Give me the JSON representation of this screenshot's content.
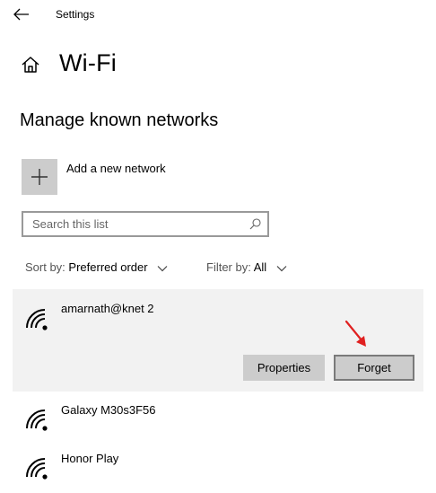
{
  "titlebar": {
    "app_title": "Settings",
    "back_icon": "arrow-left-icon"
  },
  "header": {
    "home_icon": "home-icon",
    "page_title": "Wi-Fi"
  },
  "section": {
    "title": "Manage known networks"
  },
  "add_network": {
    "label": "Add a new network",
    "icon": "plus-icon"
  },
  "search": {
    "placeholder": "Search this list",
    "value": "",
    "icon": "search-icon"
  },
  "sort": {
    "label": "Sort by:",
    "value": "Preferred order"
  },
  "filter": {
    "label": "Filter by:",
    "value": "All"
  },
  "networks": [
    {
      "name": "amarnath@knet 2",
      "selected": true
    },
    {
      "name": "Galaxy M30s3F56",
      "selected": false
    },
    {
      "name": "Honor Play",
      "selected": false
    }
  ],
  "actions": {
    "properties_label": "Properties",
    "forget_label": "Forget"
  },
  "colors": {
    "selected_bg": "#f2f2f2",
    "button_bg": "#cccccc",
    "annotation_arrow": "#e02020"
  }
}
